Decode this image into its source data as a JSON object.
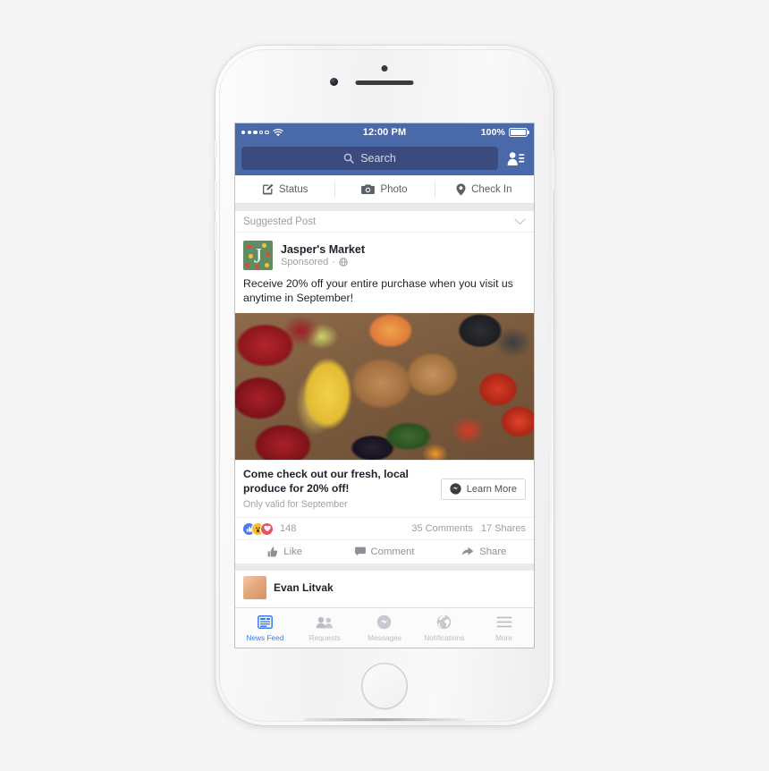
{
  "device": {
    "name": "iphone-white",
    "home_button": "home-button"
  },
  "status_bar": {
    "carrier_signal": "3 of 5 bars",
    "wifi": "wifi-icon",
    "time": "12:00 PM",
    "battery_percent": "100%",
    "battery_icon": "battery-full-icon"
  },
  "nav": {
    "search_placeholder": "Search",
    "search_icon": "search-icon",
    "requests_icon": "friend-requests-icon"
  },
  "composer": {
    "items": [
      {
        "label": "Status",
        "icon": "compose-pencil-icon"
      },
      {
        "label": "Photo",
        "icon": "camera-icon"
      },
      {
        "label": "Check In",
        "icon": "location-pin-icon"
      }
    ]
  },
  "feed": {
    "suggested_label": "Suggested Post",
    "suggested_chevron": "chevron-down-icon",
    "post": {
      "page_name": "Jasper's Market",
      "avatar_initial": "J",
      "sponsored_label": "Sponsored",
      "separator": "·",
      "privacy_icon": "globe-icon",
      "body": "Receive 20% off your entire purchase when you visit us anytime in September!",
      "photo_alt": "fresh produce crate with apples, bananas, mushrooms, tomatoes, avocados, grapes and herbs",
      "attachment": {
        "title": "Come check out our fresh, local produce for 20% off!",
        "subtitle": "Only valid for September",
        "cta_label": "Learn More",
        "cta_icon": "messenger-bubble-icon"
      },
      "engagement": {
        "reactions": [
          {
            "name": "like",
            "color": "#4c7bef"
          },
          {
            "name": "wow",
            "color": "#f7c02b"
          },
          {
            "name": "love",
            "color": "#ed5168"
          }
        ],
        "reaction_count": "148",
        "comments": "35 Comments",
        "shares": "17 Shares"
      },
      "actions": [
        {
          "label": "Like",
          "icon": "thumbs-up-icon"
        },
        {
          "label": "Comment",
          "icon": "comment-bubble-icon"
        },
        {
          "label": "Share",
          "icon": "share-arrow-icon"
        }
      ]
    },
    "next_post_peek": {
      "name": "Evan Litvak"
    }
  },
  "tab_bar": {
    "tabs": [
      {
        "label": "News Feed",
        "icon": "news-feed-icon",
        "active": true
      },
      {
        "label": "Requests",
        "icon": "friends-icon",
        "active": false
      },
      {
        "label": "Messages",
        "icon": "messenger-icon",
        "active": false
      },
      {
        "label": "Notifications",
        "icon": "globe-notifications-icon",
        "active": false
      },
      {
        "label": "More",
        "icon": "hamburger-menu-icon",
        "active": false
      }
    ]
  },
  "colors": {
    "facebook_blue": "#4a69a8",
    "search_field": "#3c4b7d",
    "active_tab": "#3b7bed",
    "text_primary": "#1d2129",
    "text_muted": "#9b9ea3"
  }
}
